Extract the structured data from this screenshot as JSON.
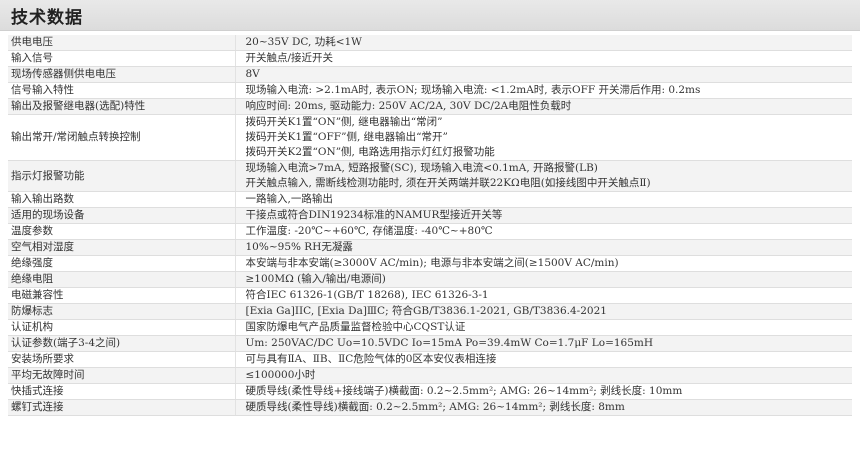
{
  "header": {
    "title": "技术数据"
  },
  "rows": [
    {
      "label": "供电电压",
      "lines": [
        "20~35V DC, 功耗<1W"
      ]
    },
    {
      "label": "输入信号",
      "lines": [
        "开关触点/接近开关"
      ]
    },
    {
      "label": "现场传感器侧供电电压",
      "lines": [
        "8V"
      ]
    },
    {
      "label": "信号输入特性",
      "lines": [
        "现场输入电流: >2.1mA时, 表示ON; 现场输入电流: <1.2mA时, 表示OFF      开关滞后作用: 0.2ms"
      ]
    },
    {
      "label": "输出及报警继电器(选配)特性",
      "lines": [
        "响应时间: 20ms, 驱动能力: 250V AC/2A, 30V DC/2A电阻性负载时"
      ]
    },
    {
      "label": "输出常开/常闭触点转换控制",
      "lines": [
        "拨码开关K1置“ON”侧, 继电器输出“常闭”",
        "拨码开关K1置“OFF”侧, 继电器输出“常开”",
        "拨码开关K2置“ON”侧, 电路选用指示灯红灯报警功能"
      ]
    },
    {
      "label": "指示灯报警功能",
      "lines": [
        "现场输入电流>7mA, 短路报警(SC), 现场输入电流<0.1mA, 开路报警(LB)",
        "开关触点输入, 需断线检测功能时, 须在开关两端并联22KΩ电阻(如接线图中开关触点Ⅱ)"
      ]
    },
    {
      "label": "输入输出路数",
      "lines": [
        "一路输入,一路输出"
      ]
    },
    {
      "label": "适用的现场设备",
      "lines": [
        "干接点或符合DIN19234标准的NAMUR型接近开关等"
      ]
    },
    {
      "label": "温度参数",
      "lines": [
        "工作温度: -20℃~+60℃, 存储温度: -40℃~+80℃"
      ]
    },
    {
      "label": "空气相对湿度",
      "lines": [
        "10%~95% RH无凝露"
      ]
    },
    {
      "label": "绝缘强度",
      "lines": [
        "本安端与非本安端(≥3000V AC/min); 电源与非本安端之间(≥1500V AC/min)"
      ]
    },
    {
      "label": "绝缘电阻",
      "lines": [
        "≥100MΩ (输入/输出/电源间)"
      ]
    },
    {
      "label": "电磁兼容性",
      "lines": [
        "符合IEC 61326-1(GB/T 18268), IEC 61326-3-1"
      ]
    },
    {
      "label": "防爆标志",
      "lines": [
        "[Exia Ga]IIC, [Exia Da]ⅢC; 符合GB/T3836.1-2021, GB/T3836.4-2021"
      ]
    },
    {
      "label": "认证机构",
      "lines": [
        "国家防爆电气产品质量监督检验中心CQST认证"
      ]
    },
    {
      "label": "认证参数(端子3-4之间)",
      "lines": [
        "Um: 250VAC/DC          Uo=10.5VDC      Io=15mA      Po=39.4mW      Co=1.7μF      Lo=165mH"
      ]
    },
    {
      "label": "安装场所要求",
      "lines": [
        "可与具有ⅡA、ⅡB、ⅡC危险气体的0区本安仪表相连接"
      ]
    },
    {
      "label": "平均无故障时间",
      "lines": [
        "≤100000小时"
      ]
    },
    {
      "label": "快插式连接",
      "lines": [
        "硬质导线(柔性导线+接线端子)横截面: 0.2~2.5mm²; AMG:  26~14mm²; 剥线长度: 10mm"
      ]
    },
    {
      "label": "螺钉式连接",
      "lines": [
        "硬质导线(柔性导线)横截面: 0.2~2.5mm²; AMG:  26~14mm²; 剥线长度: 8mm"
      ]
    }
  ]
}
